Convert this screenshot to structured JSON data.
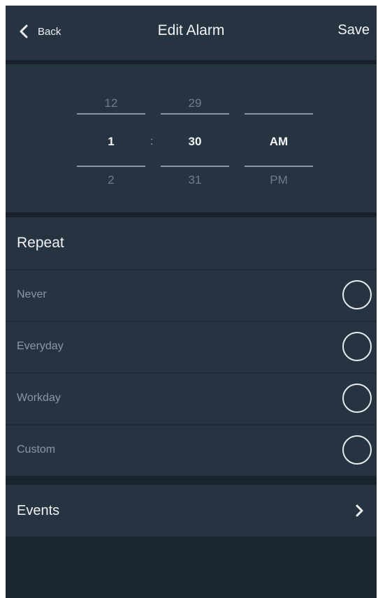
{
  "header": {
    "back_label": "Back",
    "title": "Edit Alarm",
    "save_label": "Save"
  },
  "time_picker": {
    "hour": {
      "prev": "12",
      "selected": "1",
      "next": "2"
    },
    "separator": ":",
    "minute": {
      "prev": "29",
      "selected": "30",
      "next": "31"
    },
    "period": {
      "prev": "",
      "selected": "AM",
      "next": "PM"
    }
  },
  "repeat": {
    "heading": "Repeat",
    "options": [
      {
        "label": "Never",
        "selected": false
      },
      {
        "label": "Everyday",
        "selected": false
      },
      {
        "label": "Workday",
        "selected": false
      },
      {
        "label": "Custom",
        "selected": false
      }
    ]
  },
  "events": {
    "label": "Events"
  },
  "colors": {
    "background": "#1b2633",
    "panel": "#263442",
    "text_primary": "#f1f3f6",
    "text_muted": "#8a97a4"
  },
  "icons": [
    "chevron-left-icon",
    "chevron-right-icon",
    "radio-circle-icon"
  ]
}
